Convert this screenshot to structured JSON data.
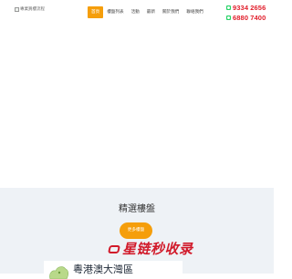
{
  "header": {
    "logo_alt": "專業買樓流程",
    "nav": [
      {
        "label": "首頁",
        "active": true
      },
      {
        "label": "樓盤列表",
        "active": false
      },
      {
        "label": "活動",
        "active": false
      },
      {
        "label": "最新",
        "active": false
      },
      {
        "label": "關於我們",
        "active": false
      },
      {
        "label": "聯絡我們",
        "active": false
      }
    ],
    "phones": [
      "9334 2656",
      "6880 7400"
    ]
  },
  "featured": {
    "title": "精選樓盤",
    "more_button": "更多樓盤"
  },
  "watermark": {
    "text": "星链秒收录"
  },
  "card": {
    "title": "粵港澳大灣區"
  },
  "colors": {
    "accent": "#f59e0b",
    "phone": "#e11d2a",
    "whatsapp": "#25d366",
    "section_bg": "#eef2f6",
    "watermark": "#d11a2a"
  }
}
